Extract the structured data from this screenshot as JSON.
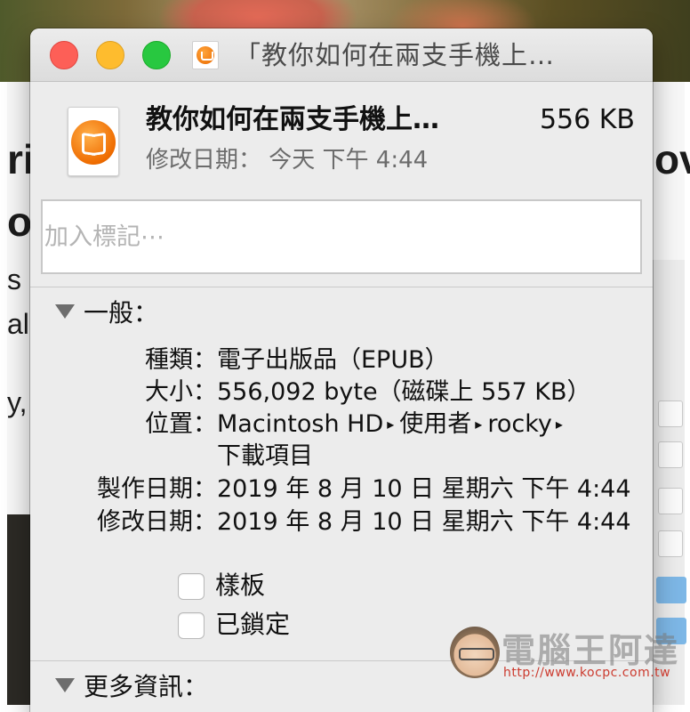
{
  "window": {
    "title": "「教你如何在兩支手機上…",
    "controls": {
      "close": "close",
      "minimize": "minimize",
      "zoom": "zoom"
    },
    "colors": {
      "close": "#fd5f57",
      "minimize": "#febc2e",
      "zoom": "#28c840"
    }
  },
  "file": {
    "icon": "ibooks-icon",
    "name": "教你如何在兩支手機上…",
    "size": "556 KB",
    "modified_summary": "修改日期：  今天 下午 4:44"
  },
  "tags": {
    "placeholder": "加入標記⋯"
  },
  "general": {
    "title": "一般：",
    "kind_label": "種類：",
    "kind_value": "電子出版品（EPUB）",
    "size_label": "大小：",
    "size_value": "556,092 byte（磁碟上 557 KB）",
    "where_label": "位置：",
    "where_path": [
      "Macintosh HD",
      "使用者",
      "rocky"
    ],
    "where_path_last": "下載項目",
    "created_label": "製作日期：",
    "created_value": "2019 年 8 月 10 日 星期六 下午 4:44",
    "modified_label": "修改日期：",
    "modified_value": "2019 年 8 月 10 日 星期六 下午 4:44",
    "stationery_label": "樣板",
    "locked_label": "已鎖定",
    "stationery_checked": false,
    "locked_checked": false
  },
  "more_info": {
    "title": "更多資訊："
  },
  "background": {
    "heading_fragments": [
      "ri",
      "o",
      "s",
      "al",
      "y,",
      "ov"
    ]
  },
  "watermark": {
    "title": "電腦王阿達",
    "url": "http://www.kocpc.com.tw"
  }
}
